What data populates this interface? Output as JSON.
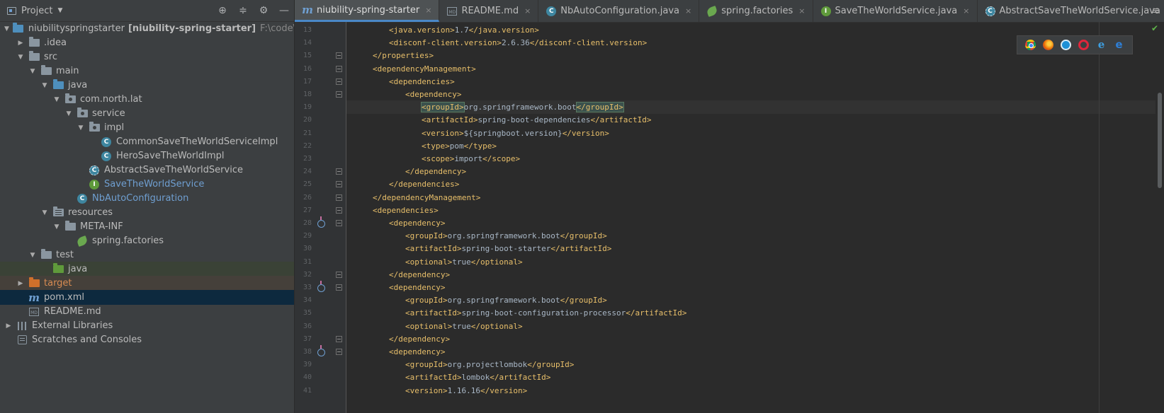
{
  "project_panel": {
    "title": "Project",
    "tools": [
      "target-icon",
      "collapse-icon",
      "gear-icon",
      "minimize-icon"
    ]
  },
  "tree": [
    {
      "depth": 0,
      "arrow": "down",
      "icon": "module-folder",
      "label": "niubilityspringstarter",
      "bold_suffix": "[niubility-spring-starter]",
      "path": "F:\\code\\niubility-"
    },
    {
      "depth": 1,
      "arrow": "right",
      "icon": "folder",
      "label": ".idea"
    },
    {
      "depth": 1,
      "arrow": "down",
      "icon": "folder",
      "label": "src"
    },
    {
      "depth": 2,
      "arrow": "down",
      "icon": "folder",
      "label": "main"
    },
    {
      "depth": 3,
      "arrow": "down",
      "icon": "folder-blue",
      "label": "java"
    },
    {
      "depth": 4,
      "arrow": "down",
      "icon": "package",
      "label": "com.north.lat"
    },
    {
      "depth": 5,
      "arrow": "down",
      "icon": "package",
      "label": "service"
    },
    {
      "depth": 6,
      "arrow": "down",
      "icon": "package",
      "label": "impl"
    },
    {
      "depth": 7,
      "arrow": "",
      "icon": "class",
      "label": "CommonSaveTheWorldServiceImpl"
    },
    {
      "depth": 7,
      "arrow": "",
      "icon": "class",
      "label": "HeroSaveTheWorldImpl"
    },
    {
      "depth": 6,
      "arrow": "",
      "icon": "abstract-class",
      "label": "AbstractSaveTheWorldService"
    },
    {
      "depth": 6,
      "arrow": "",
      "icon": "interface",
      "label": "SaveTheWorldService",
      "color": "blue"
    },
    {
      "depth": 5,
      "arrow": "",
      "icon": "class",
      "label": "NbAutoConfiguration",
      "color": "blue"
    },
    {
      "depth": 3,
      "arrow": "down",
      "icon": "resources",
      "label": "resources"
    },
    {
      "depth": 4,
      "arrow": "down",
      "icon": "folder",
      "label": "META-INF"
    },
    {
      "depth": 5,
      "arrow": "",
      "icon": "spring",
      "label": "spring.factories"
    },
    {
      "depth": 2,
      "arrow": "down",
      "icon": "folder",
      "label": "test"
    },
    {
      "depth": 3,
      "arrow": "",
      "icon": "folder-green",
      "label": "java",
      "bg": "green"
    },
    {
      "depth": 1,
      "arrow": "right",
      "icon": "folder-orange",
      "label": "target",
      "bg": "brown"
    },
    {
      "depth": 1,
      "arrow": "",
      "icon": "maven",
      "label": "pom.xml",
      "bg": "dark"
    },
    {
      "depth": 1,
      "arrow": "",
      "icon": "markdown",
      "label": "README.md"
    },
    {
      "depth": 0,
      "arrow": "right",
      "icon": "library",
      "label": "External Libraries"
    },
    {
      "depth": 0,
      "arrow": "",
      "icon": "scratch",
      "label": "Scratches and Consoles"
    }
  ],
  "tabs": [
    {
      "label": "niubility-spring-starter",
      "icon": "maven",
      "active": true
    },
    {
      "label": "README.md",
      "icon": "markdown"
    },
    {
      "label": "NbAutoConfiguration.java",
      "icon": "class"
    },
    {
      "label": "spring.factories",
      "icon": "spring"
    },
    {
      "label": "SaveTheWorldService.java",
      "icon": "interface"
    },
    {
      "label": "AbstractSaveTheWorldService.java",
      "icon": "abstract-class"
    }
  ],
  "tab_overflow": "≡",
  "tab_close": "×",
  "browsers": [
    "chrome-icon",
    "firefox-icon",
    "safari-icon",
    "opera-icon",
    "ie-icon",
    "edge-icon"
  ],
  "code_lines": [
    {
      "n": "13",
      "indent": 2,
      "parts": [
        [
          "tag",
          "<java.version>"
        ],
        [
          "txt",
          "1.7"
        ],
        [
          "tag",
          "</java.version>"
        ]
      ]
    },
    {
      "n": "14",
      "indent": 2,
      "parts": [
        [
          "tag",
          "<disconf-client.version>"
        ],
        [
          "txt",
          "2.6.36"
        ],
        [
          "tag",
          "</disconf-client.version>"
        ]
      ]
    },
    {
      "n": "15",
      "indent": 1,
      "fold": true,
      "parts": [
        [
          "tag",
          "</properties>"
        ]
      ]
    },
    {
      "n": "16",
      "indent": 1,
      "fold": true,
      "parts": [
        [
          "tag",
          "<dependencyManagement>"
        ]
      ]
    },
    {
      "n": "17",
      "indent": 2,
      "fold": true,
      "parts": [
        [
          "tag",
          "<dependencies>"
        ]
      ]
    },
    {
      "n": "18",
      "indent": 3,
      "fold": true,
      "parts": [
        [
          "tag",
          "<dependency>"
        ]
      ]
    },
    {
      "n": "19",
      "indent": 4,
      "current": true,
      "parts": [
        [
          "tag-hl",
          "<groupId>"
        ],
        [
          "txt",
          "org.springframework.boot"
        ],
        [
          "tag-hl",
          "</groupId>"
        ]
      ]
    },
    {
      "n": "20",
      "indent": 4,
      "parts": [
        [
          "tag",
          "<artifactId>"
        ],
        [
          "txt",
          "spring-boot-dependencies"
        ],
        [
          "tag",
          "</artifactId>"
        ]
      ]
    },
    {
      "n": "21",
      "indent": 4,
      "parts": [
        [
          "tag",
          "<version>"
        ],
        [
          "txt",
          "${springboot.version}"
        ],
        [
          "tag",
          "</version>"
        ]
      ]
    },
    {
      "n": "22",
      "indent": 4,
      "parts": [
        [
          "tag",
          "<type>"
        ],
        [
          "txt",
          "pom"
        ],
        [
          "tag",
          "</type>"
        ]
      ]
    },
    {
      "n": "23",
      "indent": 4,
      "parts": [
        [
          "tag",
          "<scope>"
        ],
        [
          "txt",
          "import"
        ],
        [
          "tag",
          "</scope>"
        ]
      ]
    },
    {
      "n": "24",
      "indent": 3,
      "fold": true,
      "parts": [
        [
          "tag",
          "</dependency>"
        ]
      ]
    },
    {
      "n": "25",
      "indent": 2,
      "fold": true,
      "parts": [
        [
          "tag",
          "</dependencies>"
        ]
      ]
    },
    {
      "n": "26",
      "indent": 1,
      "fold": true,
      "parts": [
        [
          "tag",
          "</dependencyManagement>"
        ]
      ]
    },
    {
      "n": "27",
      "indent": 1,
      "fold": true,
      "parts": [
        [
          "tag",
          "<dependencies>"
        ]
      ]
    },
    {
      "n": "28",
      "indent": 2,
      "fold": true,
      "gicon": true,
      "parts": [
        [
          "tag",
          "<dependency>"
        ]
      ]
    },
    {
      "n": "29",
      "indent": 3,
      "parts": [
        [
          "tag",
          "<groupId>"
        ],
        [
          "txt",
          "org.springframework.boot"
        ],
        [
          "tag",
          "</groupId>"
        ]
      ]
    },
    {
      "n": "30",
      "indent": 3,
      "parts": [
        [
          "tag",
          "<artifactId>"
        ],
        [
          "txt",
          "spring-boot-starter"
        ],
        [
          "tag",
          "</artifactId>"
        ]
      ]
    },
    {
      "n": "31",
      "indent": 3,
      "parts": [
        [
          "tag",
          "<optional>"
        ],
        [
          "txt",
          "true"
        ],
        [
          "tag",
          "</optional>"
        ]
      ]
    },
    {
      "n": "32",
      "indent": 2,
      "fold": true,
      "parts": [
        [
          "tag",
          "</dependency>"
        ]
      ]
    },
    {
      "n": "33",
      "indent": 2,
      "fold": true,
      "gicon": true,
      "parts": [
        [
          "tag",
          "<dependency>"
        ]
      ]
    },
    {
      "n": "34",
      "indent": 3,
      "parts": [
        [
          "tag",
          "<groupId>"
        ],
        [
          "txt",
          "org.springframework.boot"
        ],
        [
          "tag",
          "</groupId>"
        ]
      ]
    },
    {
      "n": "35",
      "indent": 3,
      "parts": [
        [
          "tag",
          "<artifactId>"
        ],
        [
          "txt",
          "spring-boot-configuration-processor"
        ],
        [
          "tag",
          "</artifactId>"
        ]
      ]
    },
    {
      "n": "36",
      "indent": 3,
      "parts": [
        [
          "tag",
          "<optional>"
        ],
        [
          "txt",
          "true"
        ],
        [
          "tag",
          "</optional>"
        ]
      ]
    },
    {
      "n": "37",
      "indent": 2,
      "fold": true,
      "parts": [
        [
          "tag",
          "</dependency>"
        ]
      ]
    },
    {
      "n": "38",
      "indent": 2,
      "fold": true,
      "gicon": true,
      "parts": [
        [
          "tag",
          "<dependency>"
        ]
      ]
    },
    {
      "n": "39",
      "indent": 3,
      "parts": [
        [
          "tag",
          "<groupId>"
        ],
        [
          "txt",
          "org.projectlombok"
        ],
        [
          "tag",
          "</groupId>"
        ]
      ]
    },
    {
      "n": "40",
      "indent": 3,
      "parts": [
        [
          "tag",
          "<artifactId>"
        ],
        [
          "txt",
          "lombok"
        ],
        [
          "tag",
          "</artifactId>"
        ]
      ]
    },
    {
      "n": "41",
      "indent": 3,
      "parts": [
        [
          "tag",
          "<version>"
        ],
        [
          "txt",
          "1.16.16"
        ],
        [
          "tag",
          "</version>"
        ]
      ]
    }
  ]
}
